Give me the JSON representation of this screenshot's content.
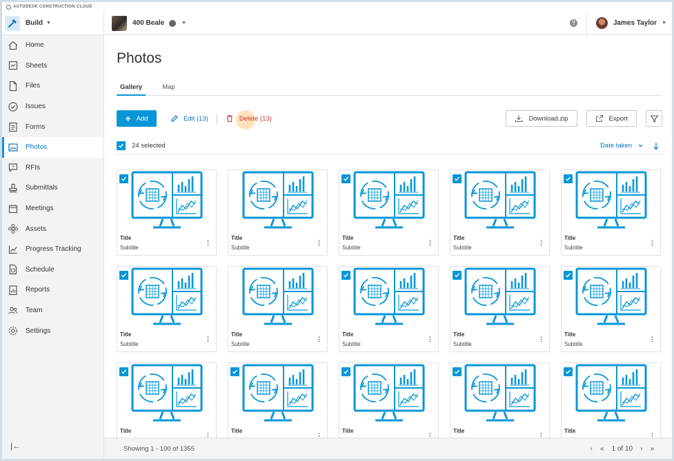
{
  "brand": {
    "text": "AUTODESK CONSTRUCTION CLOUD"
  },
  "header": {
    "product": "Build",
    "project": "400 Beale",
    "user": "James Taylor",
    "help_icon": "question-circle-icon"
  },
  "sidebar": {
    "items": [
      {
        "label": "Home",
        "icon": "home-icon"
      },
      {
        "label": "Sheets",
        "icon": "sheets-icon"
      },
      {
        "label": "Files",
        "icon": "file-icon"
      },
      {
        "label": "Issues",
        "icon": "check-circle-icon"
      },
      {
        "label": "Forms",
        "icon": "clipboard-icon"
      },
      {
        "label": "Photos",
        "icon": "photo-icon"
      },
      {
        "label": "RFIs",
        "icon": "chat-icon"
      },
      {
        "label": "Submittals",
        "icon": "stamp-icon"
      },
      {
        "label": "Meetings",
        "icon": "calendar-icon"
      },
      {
        "label": "Assets",
        "icon": "assets-icon"
      },
      {
        "label": "Progress Tracking",
        "icon": "chart-line-icon"
      },
      {
        "label": "Schedule",
        "icon": "schedule-icon"
      },
      {
        "label": "Reports",
        "icon": "report-icon"
      },
      {
        "label": "Team",
        "icon": "team-icon"
      },
      {
        "label": "Settings",
        "icon": "gear-icon"
      }
    ],
    "active": "Photos"
  },
  "page": {
    "title": "Photos",
    "tabs": [
      {
        "label": "Gallery"
      },
      {
        "label": "Map"
      }
    ],
    "active_tab": "Gallery"
  },
  "toolbar": {
    "add": "Add",
    "edit": "Edit (13)",
    "delete": "Delete (13)",
    "download": "Download.zip",
    "export": "Export"
  },
  "selection": {
    "selected": "24 selected",
    "sort_label": "Date taken"
  },
  "cards": [
    {
      "title": "Title",
      "subtitle": "Subtitle",
      "checked": true
    },
    {
      "title": "Title",
      "subtitle": "Subtitle",
      "checked": false
    },
    {
      "title": "Title",
      "subtitle": "Subtitle",
      "checked": true
    },
    {
      "title": "Title",
      "subtitle": "Subtitle",
      "checked": true
    },
    {
      "title": "Title",
      "subtitle": "Subtitle",
      "checked": true
    },
    {
      "title": "Title",
      "subtitle": "Subtitle",
      "checked": true
    },
    {
      "title": "Title",
      "subtitle": "Subtitle",
      "checked": false
    },
    {
      "title": "Title",
      "subtitle": "Subtitle",
      "checked": true
    },
    {
      "title": "Title",
      "subtitle": "Subtitle",
      "checked": true
    },
    {
      "title": "Title",
      "subtitle": "Subtitle",
      "checked": true
    },
    {
      "title": "Title",
      "subtitle": "",
      "checked": true
    },
    {
      "title": "Title",
      "subtitle": "",
      "checked": true
    },
    {
      "title": "Title",
      "subtitle": "",
      "checked": true
    },
    {
      "title": "Title",
      "subtitle": "",
      "checked": true
    },
    {
      "title": "Title",
      "subtitle": "",
      "checked": true
    }
  ],
  "footer": {
    "showing": "Showing 1 - 100 of 1355",
    "page_indicator": "1 of 10"
  },
  "colors": {
    "accent": "#0696d7",
    "delete": "#c1392b",
    "illustration": "#0696d7"
  }
}
